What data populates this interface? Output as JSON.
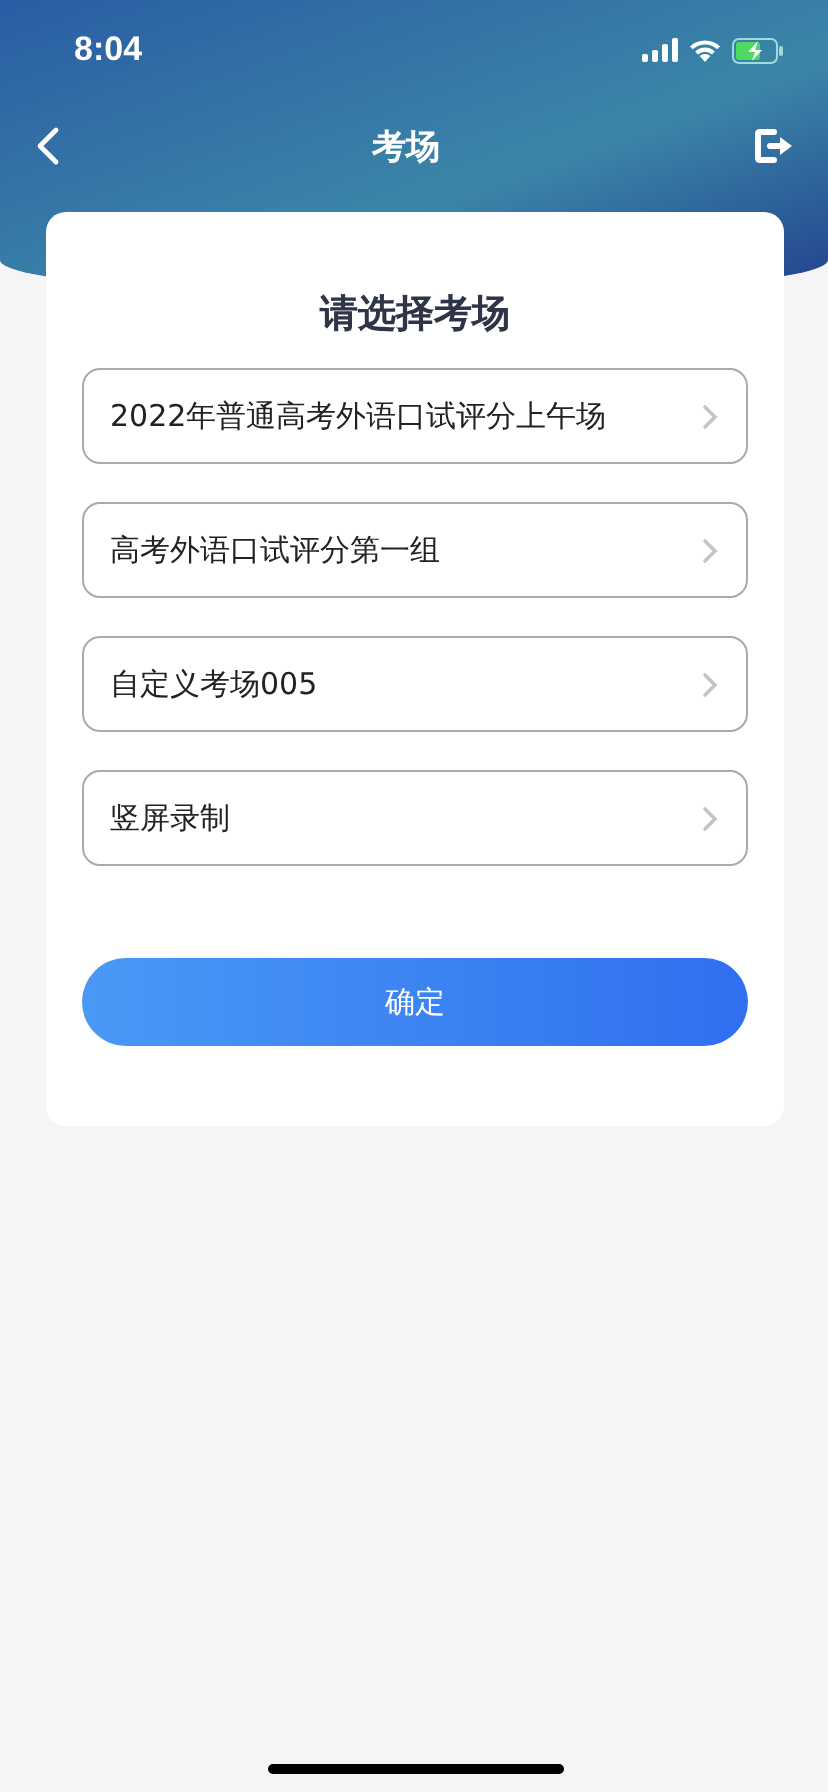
{
  "status_bar": {
    "time": "8:04"
  },
  "nav": {
    "title": "考场"
  },
  "card": {
    "heading": "请选择考场",
    "options": [
      {
        "label": "2022年普通高考外语口试评分上午场"
      },
      {
        "label": "高考外语口试评分第一组"
      },
      {
        "label": "自定义考场005"
      },
      {
        "label": "竖屏录制"
      }
    ],
    "confirm": "确定"
  }
}
